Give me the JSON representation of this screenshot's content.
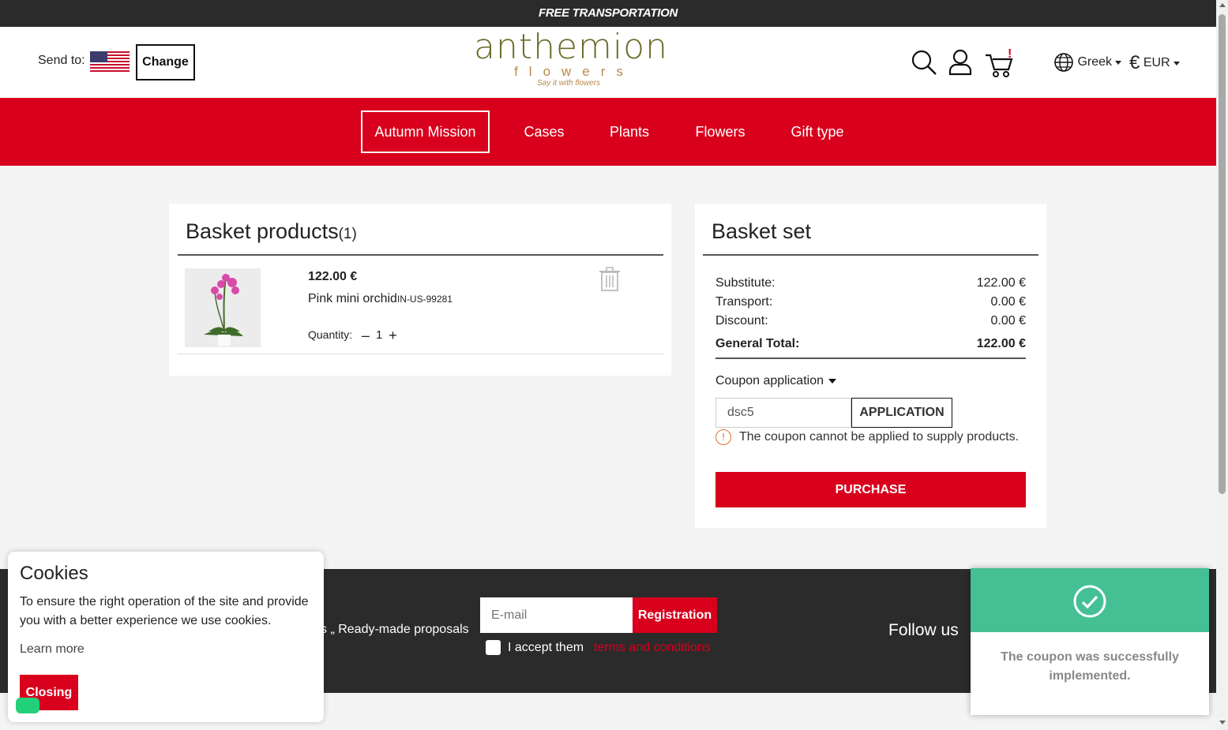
{
  "topbar": {
    "text": "FREE TRANSPORTATION"
  },
  "header": {
    "send_to_label": "Send to:",
    "change_label": "Change",
    "logo": {
      "main": "anthemion",
      "sub": "flowers",
      "tagline": "Say it with flowers"
    },
    "language": "Greek",
    "currency": "EUR",
    "icons": [
      "search-icon",
      "user-icon",
      "cart-icon",
      "globe-icon",
      "euro-icon"
    ]
  },
  "nav": {
    "items": [
      {
        "label": "Autumn Mission",
        "active": true
      },
      {
        "label": "Cases"
      },
      {
        "label": "Plants"
      },
      {
        "label": "Flowers"
      },
      {
        "label": "Gift type"
      }
    ]
  },
  "basket": {
    "title": "Basket products",
    "count": "(1)",
    "items": [
      {
        "price": "122.00 €",
        "name": "Pink mini orchid",
        "code": "IN-US-99281",
        "quantity_label": "Quantity:",
        "quantity": "1"
      }
    ]
  },
  "summary": {
    "title": "Basket set",
    "rows": [
      {
        "label": "Substitute:",
        "value": "122.00 €"
      },
      {
        "label": "Transport:",
        "value": "0.00 €"
      },
      {
        "label": "Discount:",
        "value": "0.00 €"
      }
    ],
    "total_label": "General Total:",
    "total_value": "122.00 €",
    "coupon_toggle": "Coupon application",
    "coupon_value": "dsc5",
    "apply_label": "APPLICATION",
    "error_icon": "!",
    "error": "The coupon cannot be applied to supply products.",
    "purchase_label": "PURCHASE"
  },
  "footer": {
    "links_text": "s „ Ready-made proposals",
    "email_placeholder": "E-mail",
    "register_label": "Registration",
    "accept_text": "I accept them",
    "terms_text": "terms and conditions",
    "follow_text": "Follow us"
  },
  "cookies": {
    "title": "Cookies",
    "text": "To ensure the right operation of the site and provide you with a better experience we use cookies.",
    "learn_more": "Learn more",
    "close_label": "Closing"
  },
  "toast": {
    "message": "The coupon was successfully implemented."
  },
  "colors": {
    "brand_red": "#d8001c",
    "dark": "#2b2b2b",
    "success": "#45c095",
    "logo_green": "#6b6b2a",
    "logo_gold": "#b9894b"
  }
}
